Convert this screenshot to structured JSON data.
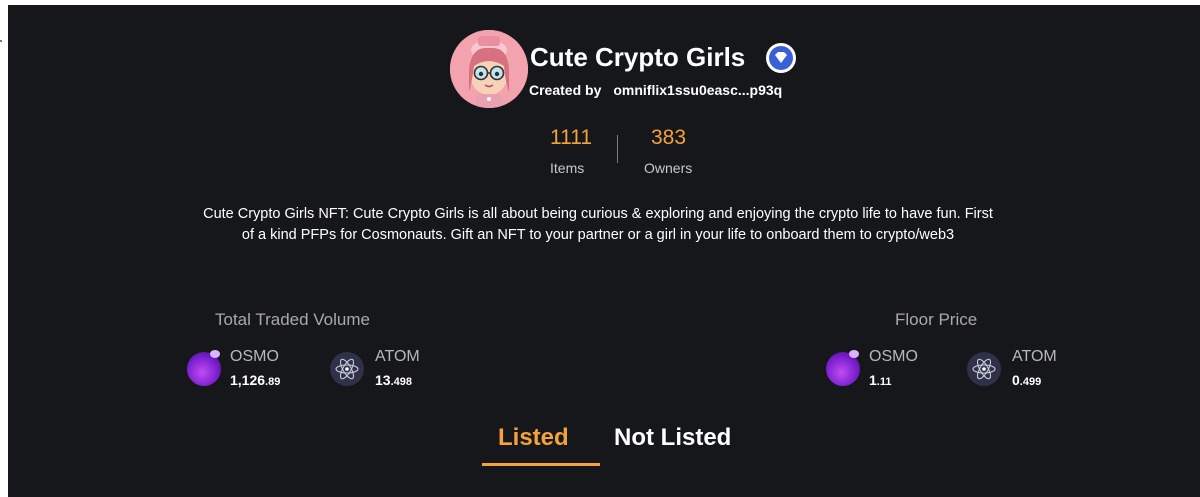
{
  "collection": {
    "name": "Cute Crypto Girls",
    "created_by_label": "Created by",
    "creator_address": "omniflix1ssu0easc...p93q",
    "items_count": "1111",
    "items_label": "Items",
    "owners_count": "383",
    "owners_label": "Owners",
    "description": "Cute Crypto Girls NFT: Cute Crypto Girls is all about being curious & exploring and enjoying the crypto life to have fun. First of a kind PFPs for Cosmonauts. Gift an NFT to your partner or a girl in your life to onboard them to crypto/web3"
  },
  "volume": {
    "title": "Total Traded Volume",
    "osmo": {
      "name": "OSMO",
      "whole": "1,126",
      "decimal": ".89"
    },
    "atom": {
      "name": "ATOM",
      "whole": "13",
      "decimal": ".498"
    }
  },
  "floor": {
    "title": "Floor Price",
    "osmo": {
      "name": "OSMO",
      "whole": "1",
      "decimal": ".11"
    },
    "atom": {
      "name": "ATOM",
      "whole": "0",
      "decimal": ".499"
    }
  },
  "tabs": {
    "listed": "Listed",
    "not_listed": "Not Listed",
    "active": "Listed"
  },
  "icons": {
    "avatar": "collection-avatar",
    "verified": "verified-badge-icon",
    "osmo": "osmo-token-icon",
    "atom": "atom-token-icon"
  },
  "colors": {
    "accent": "#f5a23a",
    "background": "#16171a",
    "verified": "#3a60d6"
  }
}
